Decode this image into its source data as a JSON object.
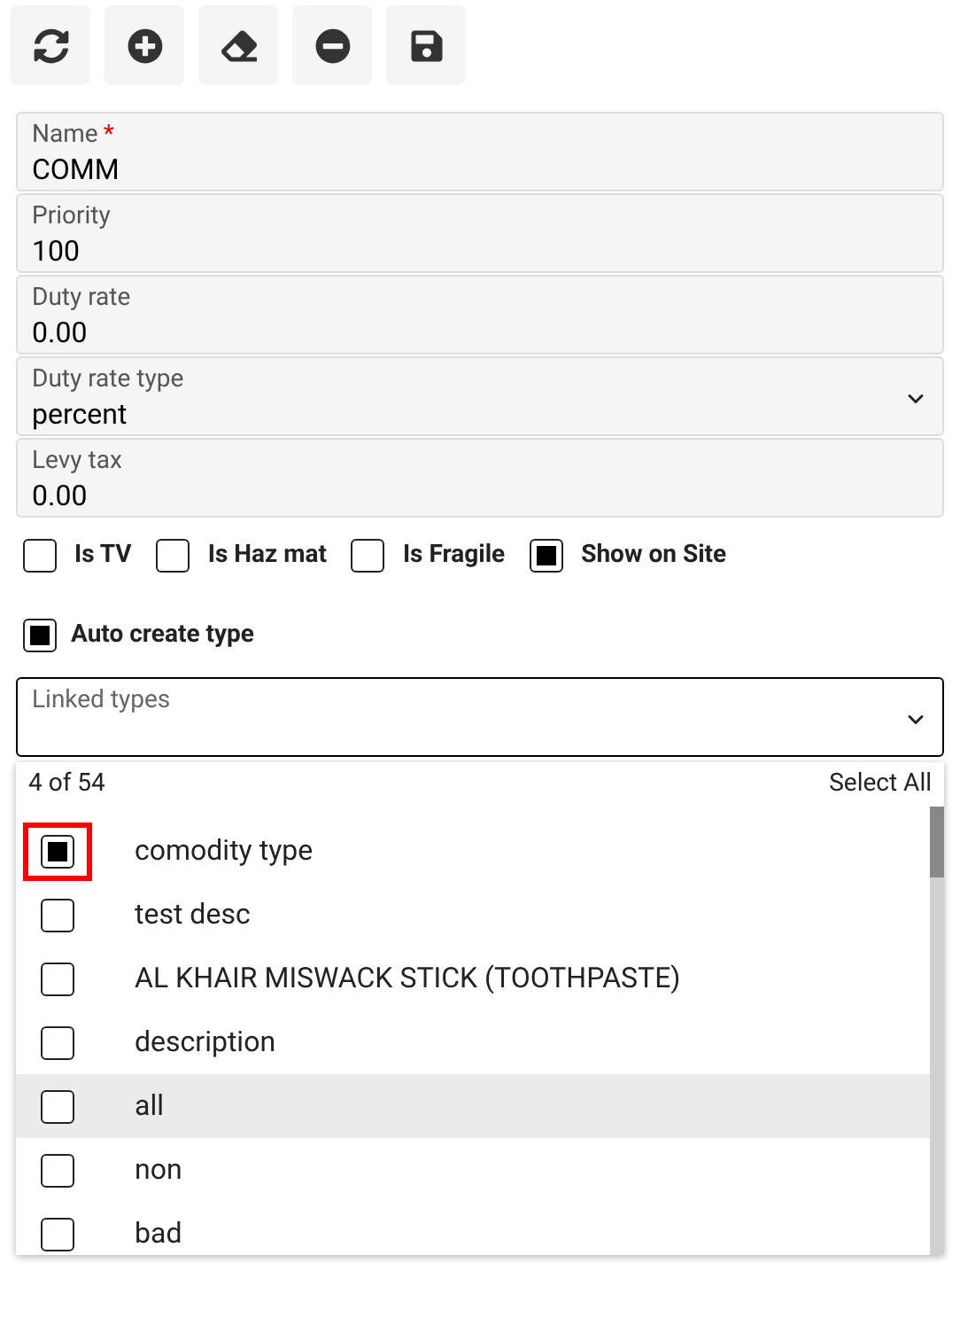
{
  "toolbar": [
    {
      "kind": "refresh"
    },
    {
      "kind": "add"
    },
    {
      "kind": "erase"
    },
    {
      "kind": "remove"
    },
    {
      "kind": "save"
    }
  ],
  "fields": [
    {
      "kind": "text",
      "label": "Name",
      "required_mark": "*",
      "value": "COMM"
    },
    {
      "kind": "text",
      "label": "Priority",
      "value": "100"
    },
    {
      "kind": "text",
      "label": "Duty rate",
      "value": "0.00"
    },
    {
      "kind": "select",
      "label": "Duty rate type",
      "value": "percent"
    },
    {
      "kind": "text",
      "label": "Levy tax",
      "value": "0.00"
    }
  ],
  "flags": [
    {
      "label": "Is TV",
      "checked": false
    },
    {
      "label": "Is Haz mat",
      "checked": false
    },
    {
      "label": "Is Fragile",
      "checked": false
    },
    {
      "label": "Show on Site",
      "checked": true
    }
  ],
  "auto_create": {
    "label": "Auto create type",
    "checked": true
  },
  "linked_types": {
    "label": "Linked types",
    "count": "4 of 54",
    "select_all": "Select All",
    "options": [
      {
        "label": "comodity type",
        "checked": true,
        "focused": true,
        "highlighted": false
      },
      {
        "label": "test desc",
        "checked": false,
        "focused": false,
        "highlighted": false
      },
      {
        "label": "AL KHAIR MISWACK STICK (TOOTHPASTE)",
        "checked": false,
        "focused": false,
        "highlighted": false
      },
      {
        "label": "description",
        "checked": false,
        "focused": false,
        "highlighted": false
      },
      {
        "label": "all",
        "checked": false,
        "focused": false,
        "highlighted": true
      },
      {
        "label": "non",
        "checked": false,
        "focused": false,
        "highlighted": false
      },
      {
        "label": "bad",
        "checked": false,
        "focused": false,
        "highlighted": false
      }
    ]
  }
}
